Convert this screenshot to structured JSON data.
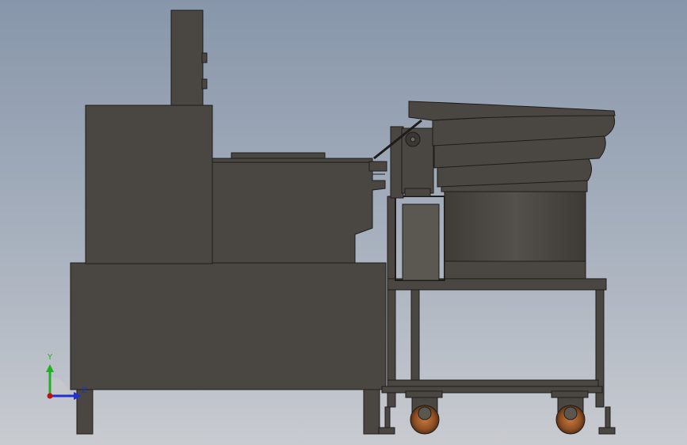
{
  "view": {
    "background_top": "#8796aa",
    "background_bottom": "#c8cbd0",
    "part_color": "#4a4641",
    "edge_color": "#1e1c1a"
  },
  "triad": {
    "y_label": "Y",
    "z_label": "Z",
    "y_color": "#20b020",
    "z_color": "#2030d0",
    "origin_color": "#c01010"
  }
}
